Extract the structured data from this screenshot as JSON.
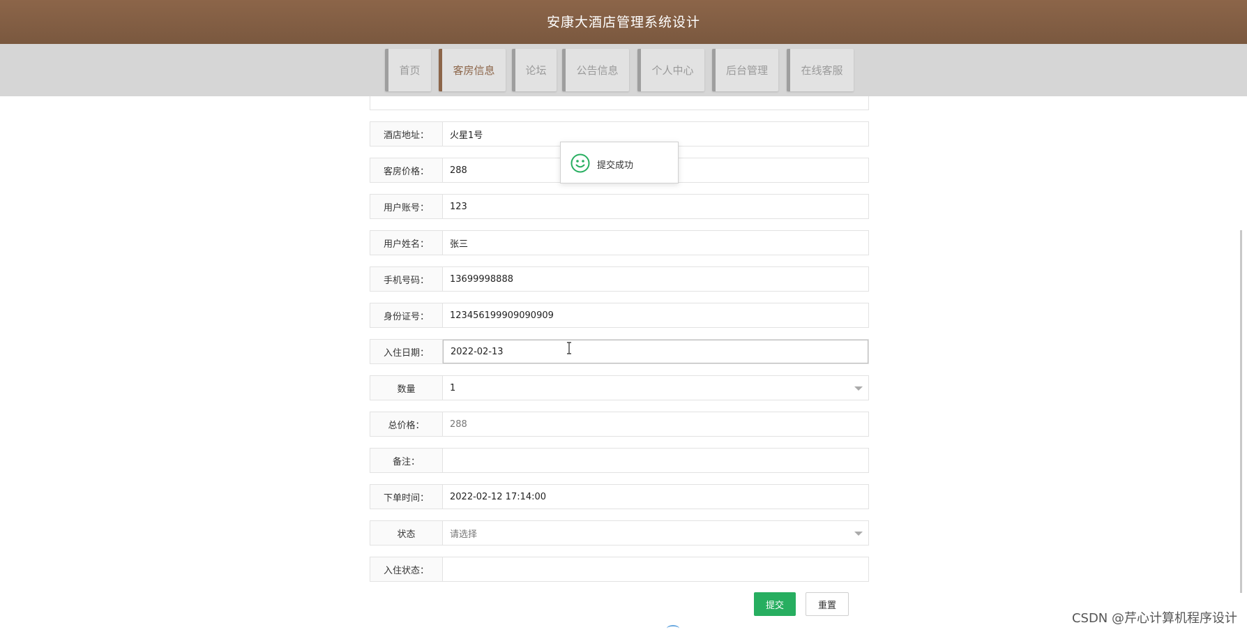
{
  "site": {
    "title": "安康大酒店管理系统设计"
  },
  "nav": {
    "items": [
      {
        "label": "首页",
        "active": false
      },
      {
        "label": "客房信息",
        "active": true
      },
      {
        "label": "论坛",
        "active": false
      },
      {
        "label": "公告信息",
        "active": false
      },
      {
        "label": "个人中心",
        "active": false
      },
      {
        "label": "后台管理",
        "active": false
      },
      {
        "label": "在线客服",
        "active": false
      }
    ]
  },
  "form": {
    "fields": [
      {
        "label": "酒店地址：",
        "value": "火星1号"
      },
      {
        "label": "客房价格：",
        "value": "288"
      },
      {
        "label": "用户账号：",
        "value": "123"
      },
      {
        "label": "用户姓名：",
        "value": "张三"
      },
      {
        "label": "手机号码：",
        "value": "13699998888"
      },
      {
        "label": "身份证号：",
        "value": "123456199909090909"
      },
      {
        "label": "入住日期：",
        "value": "2022-02-13"
      },
      {
        "label": "数量",
        "value": "1"
      },
      {
        "label": "总价格：",
        "value": "288"
      },
      {
        "label": "备注：",
        "value": ""
      },
      {
        "label": "下单时间：",
        "value": "2022-02-12 17:14:00"
      },
      {
        "label": "状态",
        "value": "请选择"
      },
      {
        "label": "入住状态：",
        "value": ""
      }
    ]
  },
  "buttons": {
    "submit": "提交",
    "reset": "重置"
  },
  "toast": {
    "message": "提交成功",
    "icon": "smile-icon"
  },
  "watermark": "CSDN @芹心计算机程序设计",
  "colors": {
    "header": "#8c6549",
    "active_nav": "#8c6549",
    "submit": "#27ae60",
    "toast_icon": "#27ae60"
  }
}
